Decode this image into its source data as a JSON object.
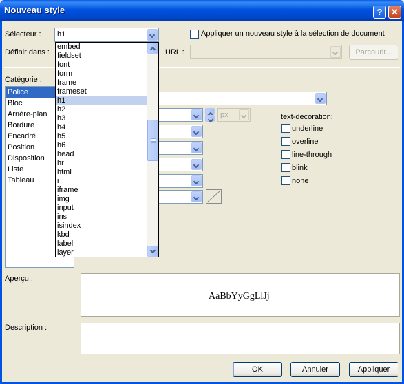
{
  "window": {
    "title": "Nouveau style",
    "help_glyph": "?",
    "close_glyph": "✕"
  },
  "selector": {
    "label": "Sélecteur :",
    "value": "h1"
  },
  "new_style_checkbox": {
    "label": "Appliquer un nouveau style à la sélection de document",
    "checked": false
  },
  "define_in": {
    "label": "Définir dans :",
    "url_label": "URL :",
    "browse_label": "Parcourir..."
  },
  "category": {
    "label": "Catégorie :",
    "items": [
      "Police",
      "Bloc",
      "Arrière-plan",
      "Bordure",
      "Encadré",
      "Position",
      "Disposition",
      "Liste",
      "Tableau"
    ],
    "selected": "Police"
  },
  "font_size_unit": "px",
  "text_decoration": {
    "label": "text-decoration:",
    "options": [
      "underline",
      "overline",
      "line-through",
      "blink",
      "none"
    ]
  },
  "dropdown_list": {
    "items": [
      "embed",
      "fieldset",
      "font",
      "form",
      "frame",
      "frameset",
      "h1",
      "h2",
      "h3",
      "h4",
      "h5",
      "h6",
      "head",
      "hr",
      "html",
      "i",
      "iframe",
      "img",
      "input",
      "ins",
      "isindex",
      "kbd",
      "label",
      "layer"
    ],
    "selected": "h1"
  },
  "preview": {
    "label": "Aperçu :",
    "sample": "AaBbYyGgLlJj"
  },
  "description": {
    "label": "Description :"
  },
  "buttons": {
    "ok": "OK",
    "cancel": "Annuler",
    "apply": "Appliquer"
  }
}
